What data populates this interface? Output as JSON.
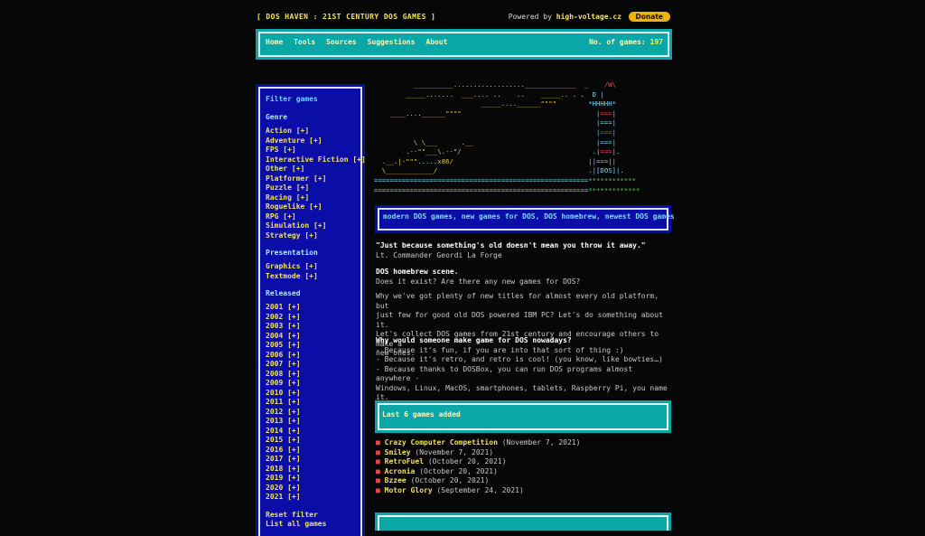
{
  "header": {
    "site_title": "[ DOS HAVEN : 21ST CENTURY DOS GAMES ]",
    "powered_by_label": "Powered by",
    "powered_by_site": "high-voltage.cz",
    "donate_label": "Donate"
  },
  "nav": {
    "links": [
      "Home",
      "Tools",
      "Sources",
      "Suggestions",
      "About"
    ],
    "games_count_label": "No. of games:",
    "games_count_value": "197"
  },
  "sidebar": {
    "title": "Filter games",
    "genre_title": "Genre",
    "genres": [
      "Action [+]",
      "Adventure [+]",
      "FPS [+]",
      "Interactive Fiction [+]",
      "Other [+]",
      "Platformer [+]",
      "Puzzle [+]",
      "Racing [+]",
      "Roguelike [+]",
      "RPG [+]",
      "Simulation [+]",
      "Strategy [+]"
    ],
    "presentation_title": "Presentation",
    "presentations": [
      "Graphics [+]",
      "Textmode [+]"
    ],
    "released_title": "Released",
    "years": [
      "2001 [+]",
      "2002 [+]",
      "2003 [+]",
      "2004 [+]",
      "2005 [+]",
      "2006 [+]",
      "2007 [+]",
      "2008 [+]",
      "2009 [+]",
      "2010 [+]",
      "2011 [+]",
      "2012 [+]",
      "2013 [+]",
      "2014 [+]",
      "2015 [+]",
      "2016 [+]",
      "2017 [+]",
      "2018 [+]",
      "2019 [+]",
      "2020 [+]",
      "2021 [+]"
    ],
    "reset_filter": "Reset filter",
    "list_all": "List all games"
  },
  "ascii_art": {
    "ship_label": "x86/",
    "tower_label": "[DOS]"
  },
  "tagline": "modern DOS games, new games for DOS, DOS homebrew, newest DOS games",
  "quote": {
    "text": "\"Just because something's old doesn't mean you throw it away.\"",
    "author": "Lt. Commander Geordi La Forge"
  },
  "homebrew": {
    "title": "DOS homebrew scene.",
    "question": "Does it exist? Are there any new games for DOS?"
  },
  "intro_paragraph": [
    "Why we've got plenty of new titles for almost every old platform, but",
    "just few for good old DOS powered IBM PC? Let's do something about it.",
    "Let's collect DOS games from 21st century and encourage others to make a",
    "new ones."
  ],
  "why": {
    "title": "Why would someone make game for DOS nowadays?",
    "lines": [
      "- Because it's fun, if you are into that sort of thing :)",
      "- Because it's retro, and retro is cool! (you know, like bowties…)",
      "- Because thanks to DOSBox, you can run DOS programs almost anywhere -",
      "Windows, Linux, MacOS, smartphones, tablets, Raspberry Pi, you name it."
    ]
  },
  "last_added": {
    "title": "Last 6 games added",
    "games": [
      {
        "name": "Crazy Computer Competition",
        "date": "(November 7, 2021)"
      },
      {
        "name": "Smiley",
        "date": "(November 7, 2021)"
      },
      {
        "name": "RetroFuel",
        "date": "(October 20, 2021)"
      },
      {
        "name": "Acronia",
        "date": "(October 20, 2021)"
      },
      {
        "name": "Bzzee",
        "date": "(October 20, 2021)"
      },
      {
        "name": "Motor Glory",
        "date": "(September 24, 2021)"
      }
    ]
  },
  "colors": {
    "accent_teal": "#0aa7a8",
    "sidebar_blue": "#0b0ea6",
    "link_yellow": "#f3e05c",
    "bullet_red": "#e84646"
  }
}
